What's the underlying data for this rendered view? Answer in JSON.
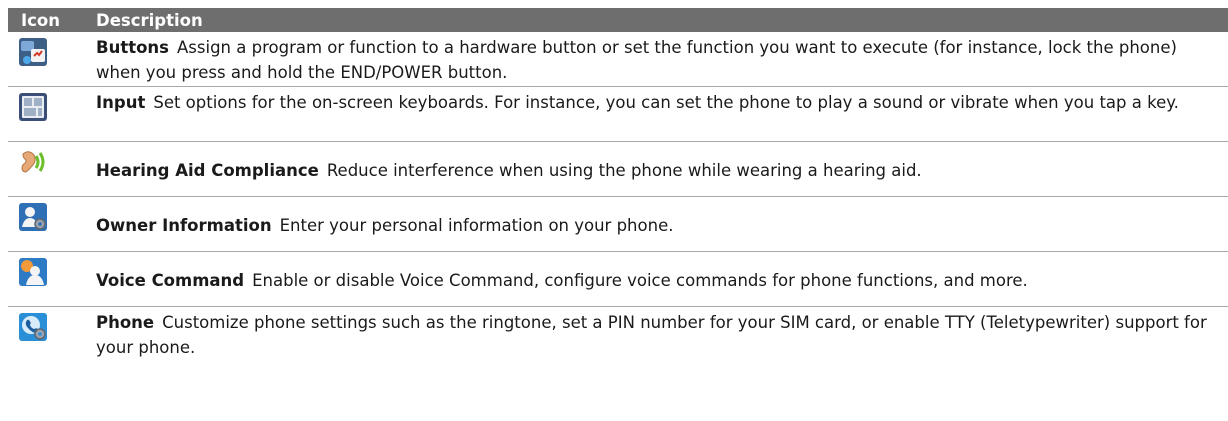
{
  "table": {
    "header": {
      "icon": "Icon",
      "description": "Description"
    },
    "rows": [
      {
        "icon": "buttons-icon",
        "name": "Buttons",
        "text": "Assign a program or function to a hardware button or set the function you want to execute (for instance, lock the phone) when you press and hold the END/POWER button."
      },
      {
        "icon": "input-icon",
        "name": "Input",
        "text": "Set options for the on-screen keyboards. For instance, you can set the phone to play a sound or vibrate when you tap a key."
      },
      {
        "icon": "hearing-aid-icon",
        "name": "Hearing Aid Compliance",
        "text": "Reduce interference when using the phone while wearing a hearing aid."
      },
      {
        "icon": "owner-information-icon",
        "name": "Owner Information",
        "text": "Enter your personal information on your phone."
      },
      {
        "icon": "voice-command-icon",
        "name": "Voice Command",
        "text": "Enable or disable Voice Command, configure voice commands for phone functions, and more."
      },
      {
        "icon": "phone-settings-icon",
        "name": "Phone",
        "text": "Customize phone settings such as the ringtone, set a PIN number for your SIM card, or enable TTY (Teletypewriter) support for your phone."
      }
    ]
  }
}
